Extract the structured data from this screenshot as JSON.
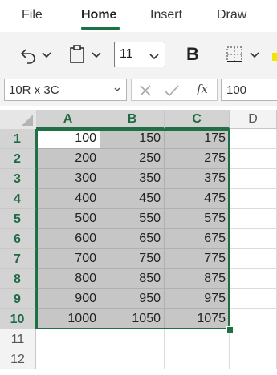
{
  "ribbon": {
    "tabs": [
      "File",
      "Home",
      "Insert",
      "Draw"
    ],
    "active_tab": "Home"
  },
  "toolbar": {
    "font_size": "11",
    "bold_label": "B",
    "icons": [
      "undo-icon",
      "clipboard-icon",
      "borders-icon"
    ]
  },
  "formula_bar": {
    "name_box": "10R x 3C",
    "fx_label": "fx",
    "value": "100"
  },
  "grid": {
    "columns": [
      "A",
      "B",
      "C",
      "D"
    ],
    "rows": [
      "1",
      "2",
      "3",
      "4",
      "5",
      "6",
      "7",
      "8",
      "9",
      "10",
      "11",
      "12"
    ],
    "cells": [
      [
        "100",
        "150",
        "175"
      ],
      [
        "200",
        "250",
        "275"
      ],
      [
        "300",
        "350",
        "375"
      ],
      [
        "400",
        "450",
        "475"
      ],
      [
        "500",
        "550",
        "575"
      ],
      [
        "600",
        "650",
        "675"
      ],
      [
        "700",
        "750",
        "775"
      ],
      [
        "800",
        "850",
        "875"
      ],
      [
        "900",
        "950",
        "975"
      ],
      [
        "1000",
        "1050",
        "1075"
      ]
    ],
    "accent_color": "#1e7145"
  }
}
